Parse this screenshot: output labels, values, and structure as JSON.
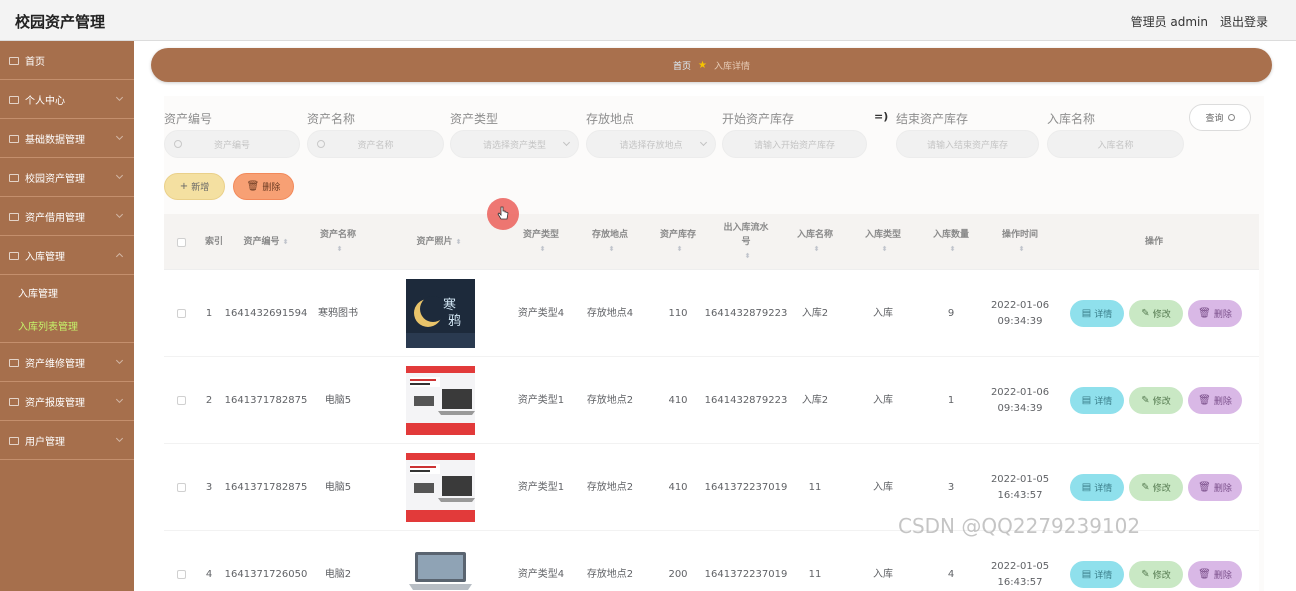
{
  "header": {
    "title": "校园资产管理",
    "user": "管理员 admin",
    "logout": "退出登录"
  },
  "sidebar": {
    "items": [
      {
        "label": "首页",
        "icon": "home-icon"
      },
      {
        "label": "个人中心",
        "icon": "user-icon"
      },
      {
        "label": "基础数据管理",
        "icon": "menu-icon"
      },
      {
        "label": "校园资产管理",
        "icon": "menu-icon"
      },
      {
        "label": "资产借用管理",
        "icon": "menu-icon"
      },
      {
        "label": "入库管理",
        "icon": "menu-icon"
      }
    ],
    "subitems": [
      {
        "label": "入库管理"
      },
      {
        "label": "入库列表管理"
      }
    ],
    "items2": [
      {
        "label": "资产维修管理",
        "icon": "menu-icon"
      },
      {
        "label": "资产报废管理",
        "icon": "menu-icon"
      },
      {
        "label": "用户管理",
        "icon": "menu-icon"
      }
    ]
  },
  "breadcrumb": {
    "home": "首页",
    "current": "入库详情"
  },
  "filters": {
    "asset_code": {
      "label": "资产编号",
      "placeholder": "资产编号"
    },
    "asset_name": {
      "label": "资产名称",
      "placeholder": "资产名称"
    },
    "asset_type": {
      "label": "资产类型",
      "placeholder": "请选择资产类型"
    },
    "location": {
      "label": "存放地点",
      "placeholder": "请选择存放地点"
    },
    "stock_start": {
      "label": "开始资产库存",
      "placeholder": "请输入开始资产库存"
    },
    "connector": "=)",
    "stock_end": {
      "label": "结束资产库存",
      "placeholder": "请输入结束资产库存"
    },
    "inbound_name": {
      "label": "入库名称",
      "placeholder": "入库名称"
    },
    "query_button": "查询"
  },
  "actions": {
    "add": "新增",
    "delete": "删除"
  },
  "table": {
    "headers": {
      "index": "索引",
      "asset_code": "资产编号",
      "asset_name": "资产名称",
      "asset_photo": "资产照片",
      "asset_type": "资产类型",
      "location": "存放地点",
      "stock": "资产库存",
      "flow_no": "出入库流水号",
      "inbound_name": "入库名称",
      "inbound_type": "入库类型",
      "quantity": "入库数量",
      "op_time": "操作时间",
      "ops": "操作"
    },
    "rows": [
      {
        "index": "1",
        "asset_code": "1641432691594",
        "asset_name": "寒鸦图书",
        "photo": "book-cover-image",
        "asset_type": "资产类型4",
        "location": "存放地点4",
        "stock": "110",
        "flow_no": "1641432879223",
        "inbound_name": "入库2",
        "inbound_type": "入库",
        "quantity": "9",
        "op_date": "2022-01-06",
        "op_clock": "09:34:39"
      },
      {
        "index": "2",
        "asset_code": "1641371782875",
        "asset_name": "电脑5",
        "photo": "laptop-ad-image",
        "asset_type": "资产类型1",
        "location": "存放地点2",
        "stock": "410",
        "flow_no": "1641432879223",
        "inbound_name": "入库2",
        "inbound_type": "入库",
        "quantity": "1",
        "op_date": "2022-01-06",
        "op_clock": "09:34:39"
      },
      {
        "index": "3",
        "asset_code": "1641371782875",
        "asset_name": "电脑5",
        "photo": "laptop-ad-image",
        "asset_type": "资产类型1",
        "location": "存放地点2",
        "stock": "410",
        "flow_no": "1641372237019",
        "inbound_name": "11",
        "inbound_type": "入库",
        "quantity": "3",
        "op_date": "2022-01-05",
        "op_clock": "16:43:57"
      },
      {
        "index": "4",
        "asset_code": "1641371726050",
        "asset_name": "电脑2",
        "photo": "laptop-image",
        "asset_type": "资产类型4",
        "location": "存放地点2",
        "stock": "200",
        "flow_no": "1641372237019",
        "inbound_name": "11",
        "inbound_type": "入库",
        "quantity": "4",
        "op_date": "2022-01-05",
        "op_clock": "16:43:57"
      }
    ],
    "row_buttons": {
      "detail": "详情",
      "edit": "修改",
      "remove": "删除"
    }
  },
  "watermark": "CSDN @QQ2279239102",
  "colors": {
    "sidebar": "#a66f4c",
    "breadcrumb": "#a9704d",
    "active_sub": "#c5f26a"
  }
}
